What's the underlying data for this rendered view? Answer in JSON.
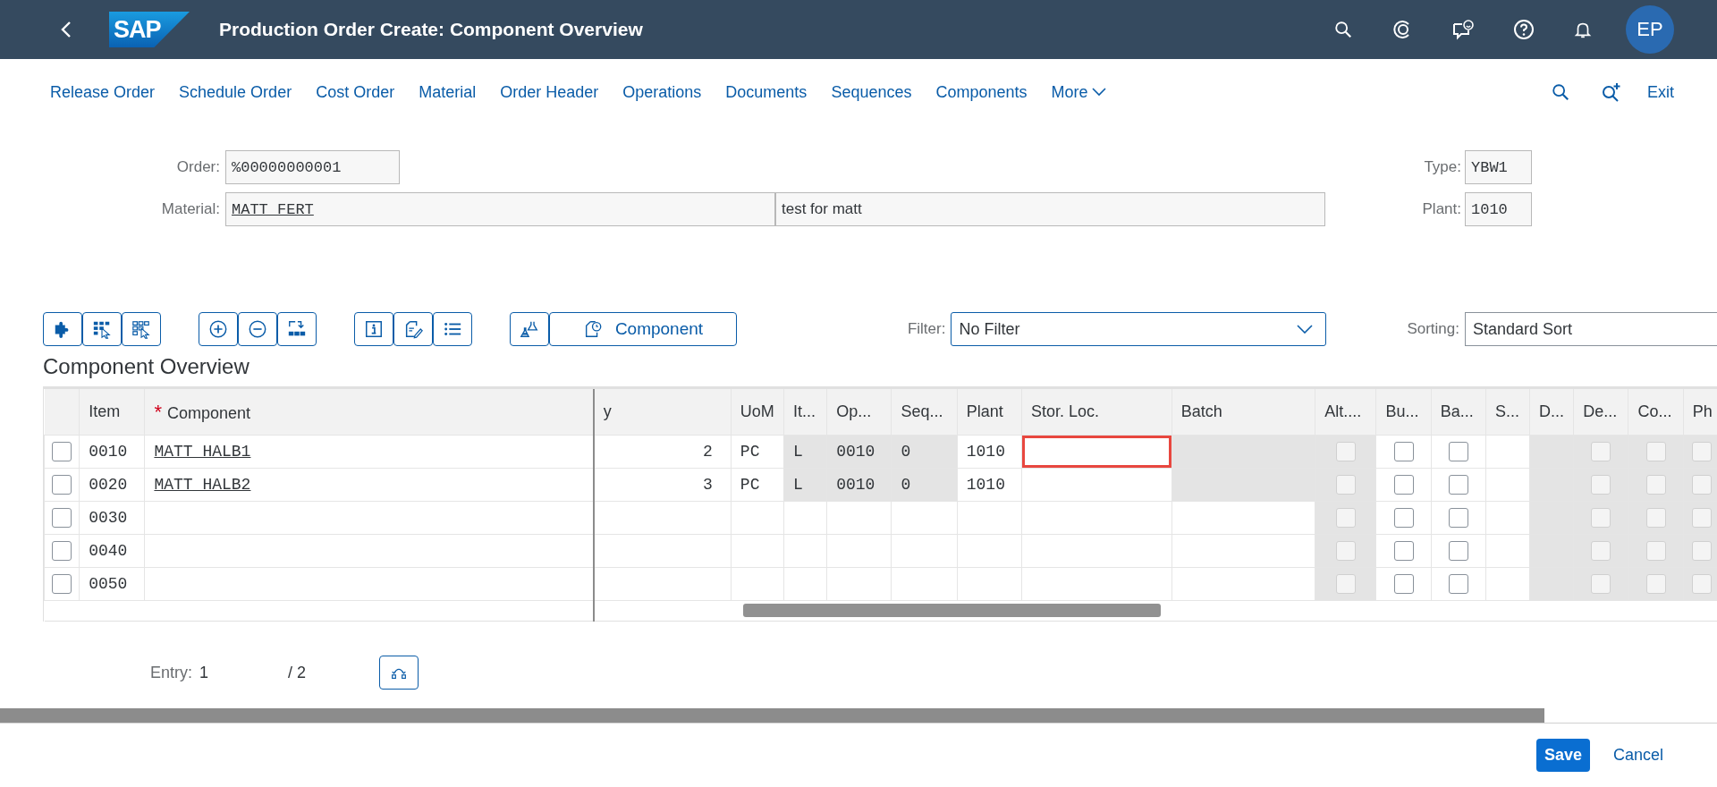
{
  "shell": {
    "title": "Production Order Create: Component Overview",
    "logo": "SAP",
    "avatar": "EP"
  },
  "menu": {
    "items": [
      "Release Order",
      "Schedule Order",
      "Cost Order",
      "Material",
      "Order Header",
      "Operations",
      "Documents",
      "Sequences",
      "Components"
    ],
    "more": "More",
    "exit": "Exit"
  },
  "header": {
    "order_label": "Order:",
    "order": "%00000000001",
    "material_label": "Material:",
    "material": "MATT_FERT",
    "material_text": "test for matt",
    "type_label": "Type:",
    "type": "YBW1",
    "plant_label": "Plant:",
    "plant": "1010"
  },
  "toolbar": {
    "component_button": "Component",
    "filter_label": "Filter:",
    "filter": "No Filter",
    "sorting_label": "Sorting:",
    "sorting": "Standard Sort"
  },
  "section_title": "Component Overview",
  "table": {
    "columns": [
      {
        "label": "Item",
        "kind": "mono"
      },
      {
        "label": "Component",
        "kind": "link",
        "marker": "*"
      },
      {
        "label": "y",
        "kind": "number"
      },
      {
        "label": "UoM",
        "kind": "mono"
      },
      {
        "label": "It...",
        "kind": "mono"
      },
      {
        "label": "Op...",
        "kind": "mono"
      },
      {
        "label": "Seq...",
        "kind": "mono"
      },
      {
        "label": "Plant",
        "kind": "mono"
      },
      {
        "label": "Stor. Loc.",
        "kind": "mono"
      },
      {
        "label": "Batch",
        "kind": "mono"
      },
      {
        "label": "Alt....",
        "kind": "checkbox"
      },
      {
        "label": "Bu...",
        "kind": "checkbox"
      },
      {
        "label": "Ba...",
        "kind": "checkbox"
      },
      {
        "label": "S...",
        "kind": "mono"
      },
      {
        "label": "D...",
        "kind": "mono"
      },
      {
        "label": "De...",
        "kind": "checkbox"
      },
      {
        "label": "Co...",
        "kind": "checkbox"
      },
      {
        "label": "Ph",
        "kind": "checkbox"
      }
    ],
    "rows": [
      {
        "selected": false,
        "cells": [
          {
            "text": "0010",
            "readonly": false,
            "highlighted": false
          },
          {
            "text": "MATT_HALB1",
            "readonly": false,
            "highlighted": false
          },
          {
            "text": "2",
            "readonly": false,
            "highlighted": false
          },
          {
            "text": "PC",
            "readonly": false,
            "highlighted": false
          },
          {
            "text": "L",
            "readonly": true,
            "highlighted": false
          },
          {
            "text": "0010",
            "readonly": true,
            "highlighted": false
          },
          {
            "text": "0",
            "readonly": true,
            "highlighted": false
          },
          {
            "text": "1010",
            "readonly": false,
            "highlighted": false
          },
          {
            "readonly": false,
            "highlighted": true
          },
          {
            "readonly": true,
            "highlighted": false
          },
          {
            "checked": false,
            "readonly": true,
            "highlighted": false
          },
          {
            "checked": false,
            "readonly": false,
            "highlighted": false
          },
          {
            "checked": false,
            "readonly": false,
            "highlighted": false
          },
          {
            "readonly": false,
            "highlighted": false
          },
          {
            "readonly": true,
            "highlighted": false
          },
          {
            "checked": false,
            "readonly": true,
            "highlighted": false
          },
          {
            "checked": false,
            "readonly": true,
            "highlighted": false
          },
          {
            "checked": false,
            "readonly": true,
            "highlighted": false
          }
        ]
      },
      {
        "selected": false,
        "cells": [
          {
            "text": "0020",
            "readonly": false,
            "highlighted": false
          },
          {
            "text": "MATT_HALB2",
            "readonly": false,
            "highlighted": false
          },
          {
            "text": "3",
            "readonly": false,
            "highlighted": false
          },
          {
            "text": "PC",
            "readonly": false,
            "highlighted": false
          },
          {
            "text": "L",
            "readonly": true,
            "highlighted": false
          },
          {
            "text": "0010",
            "readonly": true,
            "highlighted": false
          },
          {
            "text": "0",
            "readonly": true,
            "highlighted": false
          },
          {
            "text": "1010",
            "readonly": false,
            "highlighted": false
          },
          {
            "readonly": false,
            "highlighted": false
          },
          {
            "readonly": true,
            "highlighted": false
          },
          {
            "checked": false,
            "readonly": true,
            "highlighted": false
          },
          {
            "checked": false,
            "readonly": false,
            "highlighted": false
          },
          {
            "checked": false,
            "readonly": false,
            "highlighted": false
          },
          {
            "readonly": false,
            "highlighted": false
          },
          {
            "readonly": true,
            "highlighted": false
          },
          {
            "checked": false,
            "readonly": true,
            "highlighted": false
          },
          {
            "checked": false,
            "readonly": true,
            "highlighted": false
          },
          {
            "checked": false,
            "readonly": true,
            "highlighted": false
          }
        ]
      },
      {
        "selected": false,
        "cells": [
          {
            "text": "0030",
            "readonly": false,
            "highlighted": false
          },
          {
            "readonly": false,
            "highlighted": false
          },
          {
            "readonly": false,
            "highlighted": false
          },
          {
            "readonly": false,
            "highlighted": false
          },
          {
            "readonly": false,
            "highlighted": false
          },
          {
            "readonly": false,
            "highlighted": false
          },
          {
            "readonly": false,
            "highlighted": false
          },
          {
            "readonly": false,
            "highlighted": false
          },
          {
            "readonly": false,
            "highlighted": false
          },
          {
            "readonly": false,
            "highlighted": false
          },
          {
            "checked": false,
            "readonly": true,
            "highlighted": false
          },
          {
            "checked": false,
            "readonly": false,
            "highlighted": false
          },
          {
            "checked": false,
            "readonly": false,
            "highlighted": false
          },
          {
            "readonly": false,
            "highlighted": false
          },
          {
            "readonly": true,
            "highlighted": false
          },
          {
            "checked": false,
            "readonly": true,
            "highlighted": false
          },
          {
            "checked": false,
            "readonly": true,
            "highlighted": false
          },
          {
            "checked": false,
            "readonly": true,
            "highlighted": false
          }
        ]
      },
      {
        "selected": false,
        "cells": [
          {
            "text": "0040",
            "readonly": false,
            "highlighted": false
          },
          {
            "readonly": false,
            "highlighted": false
          },
          {
            "readonly": false,
            "highlighted": false
          },
          {
            "readonly": false,
            "highlighted": false
          },
          {
            "readonly": false,
            "highlighted": false
          },
          {
            "readonly": false,
            "highlighted": false
          },
          {
            "readonly": false,
            "highlighted": false
          },
          {
            "readonly": false,
            "highlighted": false
          },
          {
            "readonly": false,
            "highlighted": false
          },
          {
            "readonly": false,
            "highlighted": false
          },
          {
            "checked": false,
            "readonly": true,
            "highlighted": false
          },
          {
            "checked": false,
            "readonly": false,
            "highlighted": false
          },
          {
            "checked": false,
            "readonly": false,
            "highlighted": false
          },
          {
            "readonly": false,
            "highlighted": false
          },
          {
            "readonly": true,
            "highlighted": false
          },
          {
            "checked": false,
            "readonly": true,
            "highlighted": false
          },
          {
            "checked": false,
            "readonly": true,
            "highlighted": false
          },
          {
            "checked": false,
            "readonly": true,
            "highlighted": false
          }
        ]
      },
      {
        "selected": false,
        "cells": [
          {
            "text": "0050",
            "readonly": false,
            "highlighted": false
          },
          {
            "readonly": false,
            "highlighted": false
          },
          {
            "readonly": false,
            "highlighted": false
          },
          {
            "readonly": false,
            "highlighted": false
          },
          {
            "readonly": false,
            "highlighted": false
          },
          {
            "readonly": false,
            "highlighted": false
          },
          {
            "readonly": false,
            "highlighted": false
          },
          {
            "readonly": false,
            "highlighted": false
          },
          {
            "readonly": false,
            "highlighted": false
          },
          {
            "readonly": false,
            "highlighted": false
          },
          {
            "checked": false,
            "readonly": true,
            "highlighted": false
          },
          {
            "checked": false,
            "readonly": false,
            "highlighted": false
          },
          {
            "checked": false,
            "readonly": false,
            "highlighted": false
          },
          {
            "readonly": false,
            "highlighted": false
          },
          {
            "readonly": true,
            "highlighted": false
          },
          {
            "checked": false,
            "readonly": true,
            "highlighted": false
          },
          {
            "checked": false,
            "readonly": true,
            "highlighted": false
          },
          {
            "checked": false,
            "readonly": true,
            "highlighted": false
          }
        ]
      }
    ]
  },
  "entry": {
    "label": "Entry:",
    "value": "1",
    "total": "/ 2"
  },
  "footer": {
    "save": "Save",
    "cancel": "Cancel"
  }
}
